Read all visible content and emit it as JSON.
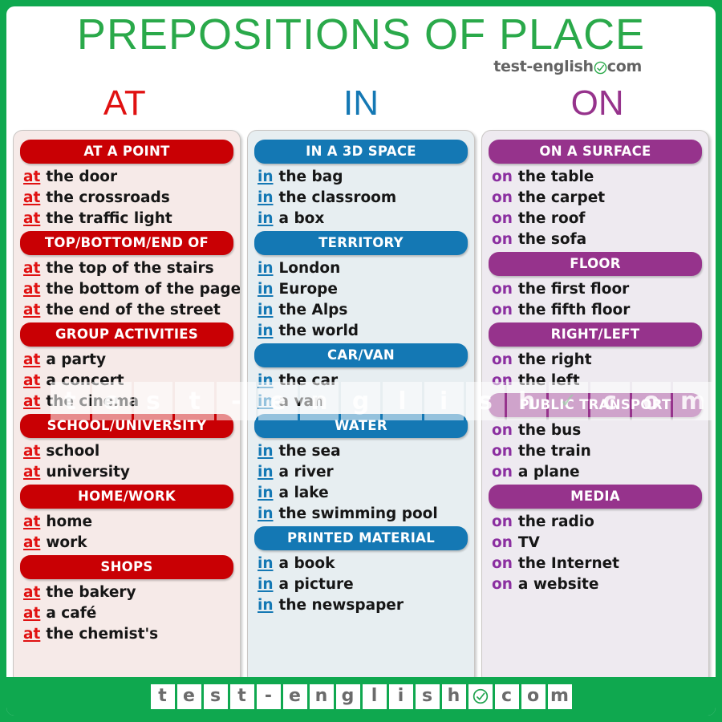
{
  "header": {
    "title": "PREPOSITIONS OF PLACE",
    "brand_prefix": "test-english",
    "brand_suffix": "com",
    "brand_check_icon": "check-circle-icon"
  },
  "colors": {
    "green": "#0FA84F",
    "title_green": "#2AA94A",
    "at_red": "#E01111",
    "at_bar_red": "#C90004",
    "in_blue": "#1478B4",
    "on_purple": "#96338C"
  },
  "column_heads": [
    {
      "label": "AT",
      "key": "at"
    },
    {
      "label": "IN",
      "key": "in"
    },
    {
      "label": "ON",
      "key": "on"
    }
  ],
  "columns": {
    "at": {
      "preposition": "at",
      "groups": [
        {
          "title": "AT A POINT",
          "items": [
            "the door",
            "the crossroads",
            "the traffic light"
          ]
        },
        {
          "title": "TOP/BOTTOM/END OF",
          "items": [
            "the top  of the stairs",
            "the bottom of the page",
            "the end of the street"
          ]
        },
        {
          "title": "GROUP ACTIVITIES",
          "items": [
            "a party",
            "a concert",
            "the cinema"
          ]
        },
        {
          "title": "SCHOOL/UNIVERSITY",
          "items": [
            "school",
            "university"
          ]
        },
        {
          "title": "HOME/WORK",
          "items": [
            "home",
            "work"
          ]
        },
        {
          "title": "SHOPS",
          "items": [
            "the bakery",
            "a café",
            "the chemist's"
          ]
        }
      ]
    },
    "in": {
      "preposition": "in",
      "groups": [
        {
          "title": "IN A 3D SPACE",
          "items": [
            "the bag",
            "the classroom",
            "a box"
          ]
        },
        {
          "title": "TERRITORY",
          "items": [
            "London",
            "Europe",
            "the Alps",
            "the world"
          ]
        },
        {
          "title": "CAR/VAN",
          "items": [
            "the car",
            "a van"
          ]
        },
        {
          "title": "WATER",
          "items": [
            "the sea",
            "a river",
            "a lake",
            "the swimming pool"
          ]
        },
        {
          "title": "PRINTED MATERIAL",
          "items": [
            "a book",
            "a picture",
            "the newspaper"
          ]
        }
      ]
    },
    "on": {
      "preposition": "on",
      "groups": [
        {
          "title": "ON A SURFACE",
          "items": [
            "the table",
            "the carpet",
            "the roof",
            "the sofa"
          ]
        },
        {
          "title": "FLOOR",
          "items": [
            "the first floor",
            "the fifth floor"
          ]
        },
        {
          "title": "RIGHT/LEFT",
          "items": [
            "the right",
            "the left"
          ]
        },
        {
          "title": "PUBLIC TRANSPORT",
          "items": [
            "the bus",
            "the train",
            "a plane"
          ]
        },
        {
          "title": "MEDIA",
          "items": [
            "the radio",
            "TV",
            "the Internet",
            "a website"
          ]
        }
      ]
    }
  },
  "watermark": {
    "tiles": [
      "t",
      "e",
      "s",
      "t",
      "-",
      "e",
      "n",
      "g",
      "l",
      "i",
      "s",
      "h",
      "✓",
      "c",
      "o",
      "m"
    ]
  },
  "footer": {
    "tiles": [
      "t",
      "e",
      "s",
      "t",
      "-",
      "e",
      "n",
      "g",
      "l",
      "i",
      "s",
      "h",
      "check",
      "c",
      "o",
      "m"
    ],
    "check_icon": "check-circle-icon"
  }
}
